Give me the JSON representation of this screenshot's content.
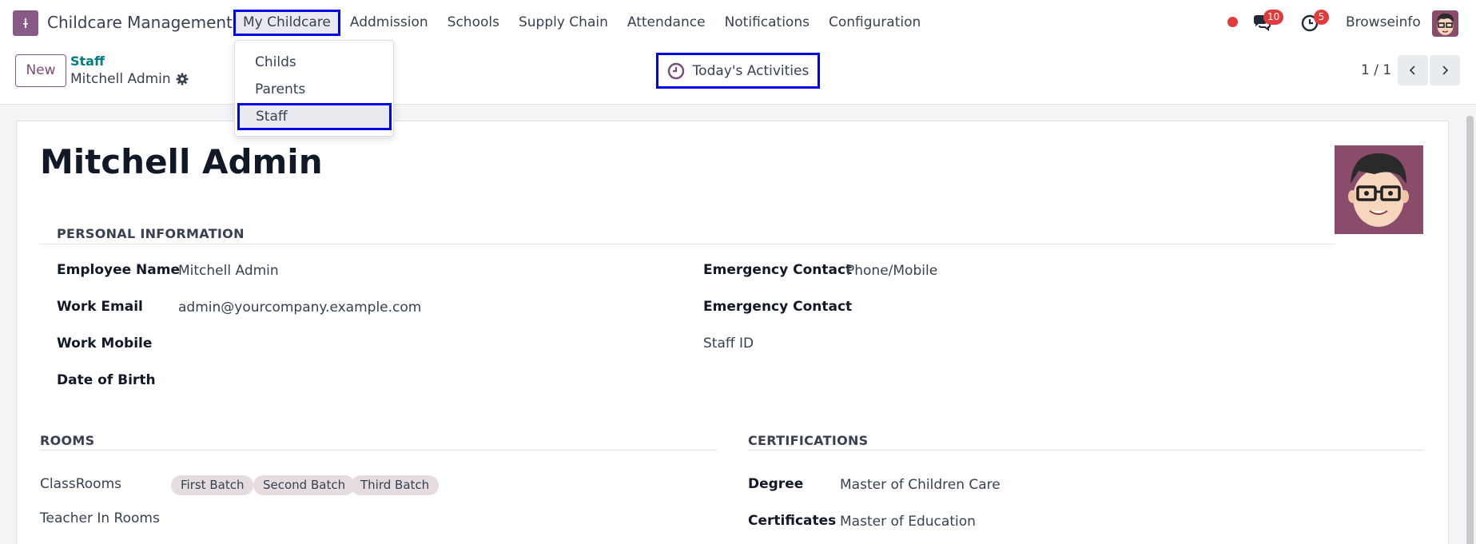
{
  "navbar": {
    "app_name": "Childcare Management",
    "menu": [
      "My Childcare",
      "Addmission",
      "Schools",
      "Supply Chain",
      "Attendance",
      "Notifications",
      "Configuration"
    ],
    "messages_badge": "10",
    "activities_badge": "5",
    "user_name": "Browseinfo"
  },
  "dropdown": {
    "items": [
      "Childs",
      "Parents",
      "Staff"
    ]
  },
  "control_panel": {
    "new_label": "New",
    "breadcrumb": "Staff",
    "record_name": "Mitchell Admin",
    "activities_label": "Today's Activities",
    "pager": "1 / 1"
  },
  "form": {
    "title": "Mitchell Admin",
    "personal_section": "PERSONAL INFORMATION",
    "employee_name_label": "Employee Name",
    "employee_name": "Mitchell Admin",
    "work_email_label": "Work Email",
    "work_email": "admin@yourcompany.example.com",
    "work_mobile_label": "Work Mobile",
    "dob_label": "Date of Birth",
    "emergency_contact_label": "Emergency Contact",
    "emergency_contact_value": "Phone/Mobile",
    "emergency_contact2_label": "Emergency Contact",
    "staff_id_label": "Staff ID",
    "rooms_section": "ROOMS",
    "classrooms_label": "ClassRooms",
    "classrooms": [
      "First Batch",
      "Second Batch",
      "Third Batch"
    ],
    "teacher_rooms_label": "Teacher In Rooms",
    "certifications_section": "CERTIFICATIONS",
    "degree_label": "Degree",
    "degree": "Master of Children Care",
    "certificates_label": "Certificates",
    "certificates": "Master of Education"
  },
  "colors": {
    "brand": "#8a5a86",
    "highlight": "#0000e6",
    "badge": "#e03c3c",
    "link": "#017e84"
  }
}
